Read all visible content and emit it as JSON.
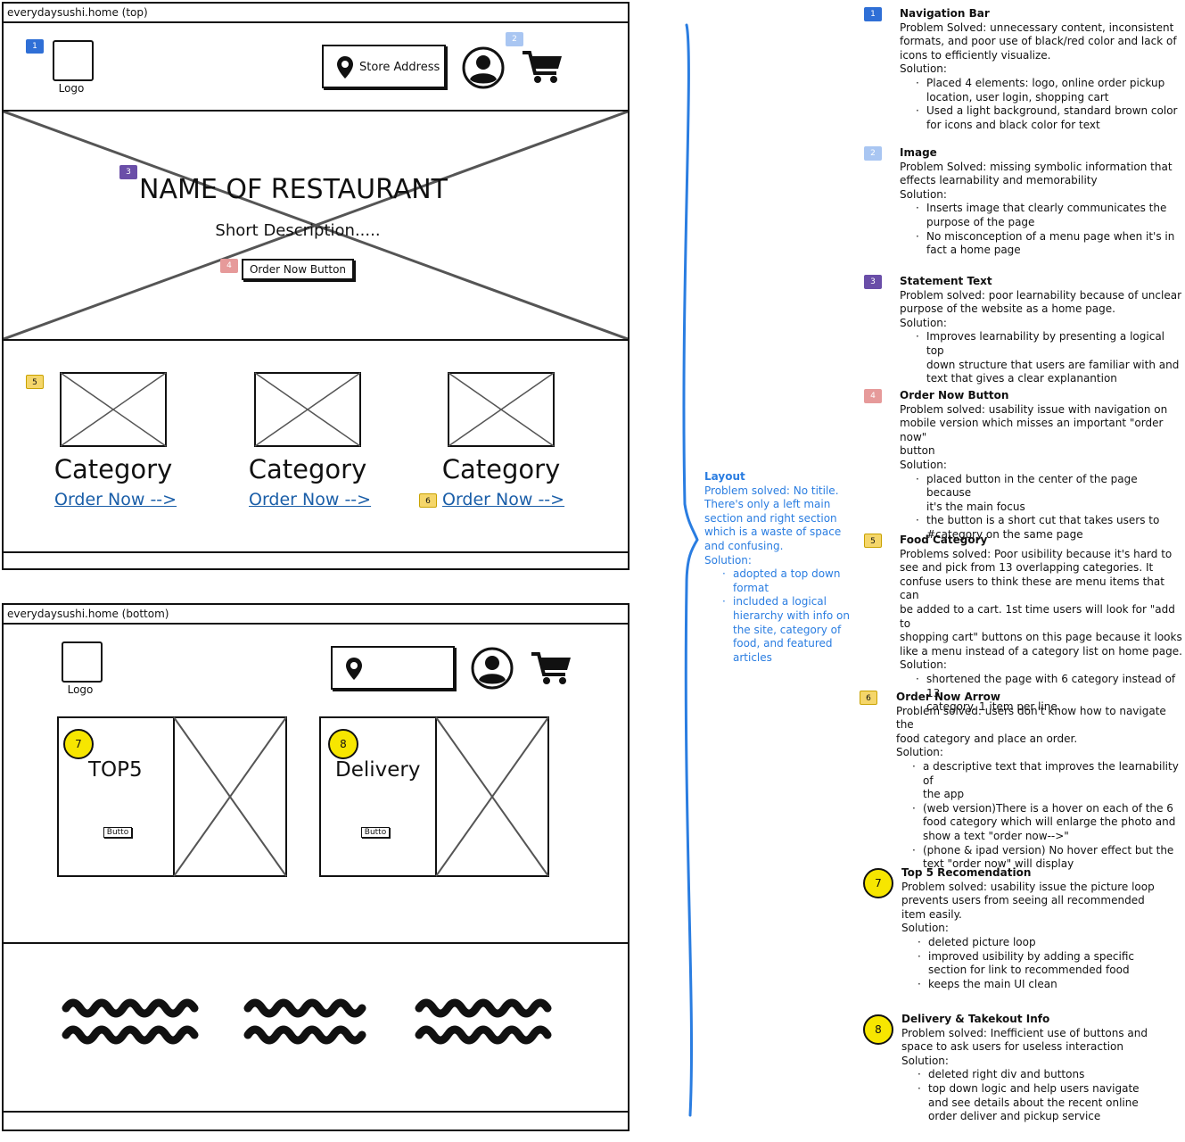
{
  "colors": {
    "badge1": "#2f6fd6",
    "badge2": "#a9c6f2",
    "badge3": "#6a4ea8",
    "badge4": "#e69a9a",
    "badge5": "#f5d66a",
    "badge6": "#f5d66a",
    "highlight": "#f7e600",
    "link": "#1a5ea8",
    "annotation": "#2a7de1"
  },
  "top_frame": {
    "title": "everydaysushi.home (top)",
    "logo_label": "Logo",
    "store_button": "Store Address",
    "icons": [
      "location-pin-icon",
      "user-avatar-icon",
      "shopping-cart-icon"
    ],
    "badges": {
      "b1": "1",
      "b2": "2",
      "b3": "3",
      "b4": "4",
      "b5": "5",
      "b6": "6"
    },
    "hero": {
      "title": "NAME OF RESTAURANT",
      "description": "Short Description.....",
      "button": "Order Now Button"
    },
    "categories": [
      {
        "title": "Category",
        "link": "Order Now -->"
      },
      {
        "title": "Category",
        "link": "Order Now -->"
      },
      {
        "title": "Category",
        "link": "Order Now -->"
      }
    ]
  },
  "bottom_frame": {
    "title": "everydaysushi.home (bottom)",
    "logo_label": "Logo",
    "cards": [
      {
        "badge": "7",
        "title": "TOP5",
        "button": "Butto"
      },
      {
        "badge": "8",
        "title": "Delivery",
        "button": "Butto"
      }
    ]
  },
  "layout_note": {
    "title": "Layout",
    "lines": [
      "Problem solved: No titile.",
      "There's only a left main",
      "section and right section",
      "which is a waste of space",
      "and confusing.",
      "Solution:"
    ],
    "bullets": [
      [
        "adopted a top down",
        "format"
      ],
      [
        "included a logical",
        "hierarchy with info on",
        "the site, category of",
        "food, and featured",
        "articles"
      ]
    ]
  },
  "notes": [
    {
      "badge": "1",
      "title": "Navigation Bar",
      "lines": [
        "Problem Solved: unnecessary content, inconsistent",
        "formats, and poor use of black/red color and lack of",
        "icons to efficiently visualize.",
        "Solution:"
      ],
      "bullets": [
        [
          "Placed 4 elements: logo, online order pickup",
          "location, user login, shopping cart"
        ],
        [
          "Used a light background, standard brown color",
          "for icons and black color for text"
        ]
      ]
    },
    {
      "badge": "2",
      "title": "Image",
      "lines": [
        "Problem Solved:  missing symbolic information that",
        "effects learnability and memorability",
        "Solution:"
      ],
      "bullets": [
        [
          "Inserts image that clearly communicates the",
          "purpose of the page"
        ],
        [
          "No misconception of a menu page when it's in",
          "fact a home page"
        ]
      ]
    },
    {
      "badge": "3",
      "title": "Statement Text",
      "lines": [
        "Problem solved: poor learnability because of unclear",
        "purpose of the website as a home page.",
        "Solution:"
      ],
      "bullets": [
        [
          "Improves learnability by presenting a logical top",
          "down structure that users are familiar with and",
          "text that gives a clear explanantion"
        ]
      ]
    },
    {
      "badge": "4",
      "title": "Order Now Button",
      "lines": [
        "Problem solved: usability issue with navigation on",
        "mobile version which misses an important \"order now\"",
        "button",
        "Solution:"
      ],
      "bullets": [
        [
          "placed button in the center of the page because",
          "it's the main focus"
        ],
        [
          "the button is a short cut that takes users to",
          "#category on the same page"
        ]
      ]
    },
    {
      "badge": "5",
      "title": "Food Category",
      "lines": [
        "Problems solved:  Poor usibility because it's hard to",
        "see and pick from 13 overlapping categories. It",
        "confuse users to think these are menu items that can",
        "be added to a cart. 1st time users will look for \"add to",
        "shopping cart\" buttons on this page because it looks",
        "like a menu instead of a category list on home page.",
        "Solution:"
      ],
      "bullets": [
        [
          "shortened the page with 6 category instead of 13",
          "category. 1 item per line."
        ]
      ]
    },
    {
      "badge": "6",
      "title": "Order Now Arrow",
      "lines": [
        "Problem solved: users don't know how to navigate the",
        "food category and place an order.",
        "Solution:"
      ],
      "bullets": [
        [
          "a descriptive text that improves the learnability of",
          "the app"
        ],
        [
          "(web version)There is a hover on each of the 6",
          "food category which will enlarge the photo and",
          "show a text \"order now-->\""
        ],
        [
          "(phone & ipad version) No hover effect but the",
          "text \"order now\" will display"
        ]
      ]
    },
    {
      "badge": "7",
      "title": "Top 5 Recomendation",
      "lines": [
        "Problem solved: usability issue the picture loop",
        "prevents users from seeing all recommended",
        "item easily.",
        "Solution:"
      ],
      "bullets": [
        [
          "deleted picture loop"
        ],
        [
          "improved usibility by adding a specific",
          "section for link to recommended food"
        ],
        [
          "keeps the main UI clean"
        ]
      ]
    },
    {
      "badge": "8",
      "title": "Delivery & Takekout Info",
      "lines": [
        "Problem solved:  Inefficient use of buttons and",
        "space to ask users for useless interaction",
        "Solution:"
      ],
      "bullets": [
        [
          "deleted right div and buttons"
        ],
        [
          "top down logic and help users navigate",
          "and see details about the recent online",
          "order deliver and pickup service"
        ]
      ]
    }
  ]
}
